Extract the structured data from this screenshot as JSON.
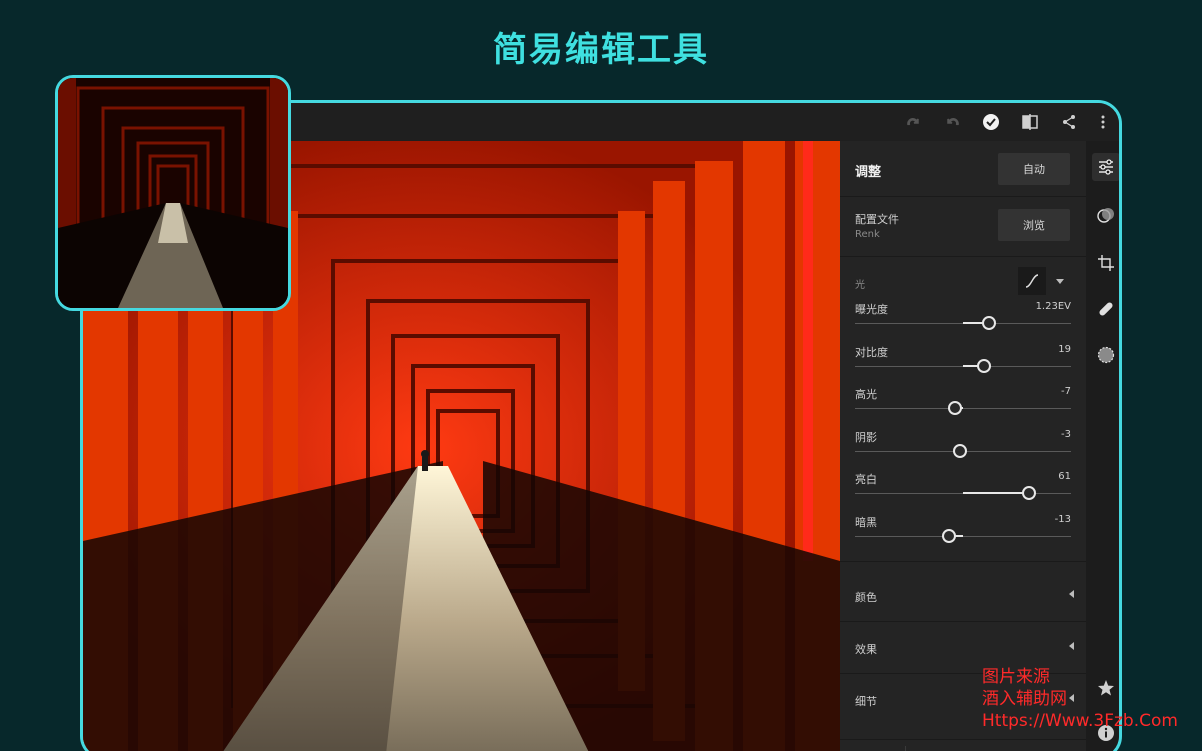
{
  "headline": "简易编辑工具",
  "topbar": {
    "icons": [
      "redo-icon",
      "undo-icon",
      "done-check-icon",
      "compare-icon",
      "share-icon",
      "more-vertical-icon"
    ]
  },
  "panel": {
    "title": "调整",
    "auto_label": "自动",
    "profile_label": "配置文件",
    "profile_value": "Renk",
    "browse_label": "浏览",
    "light_label": "光",
    "sliders": [
      {
        "name": "曝光度",
        "value": "1.23EV",
        "pos": 0.62
      },
      {
        "name": "对比度",
        "value": "19",
        "pos": 0.595
      },
      {
        "name": "高光",
        "value": "-7",
        "pos": 0.465
      },
      {
        "name": "阴影",
        "value": "-3",
        "pos": 0.485
      },
      {
        "name": "亮白",
        "value": "61",
        "pos": 0.805
      },
      {
        "name": "暗黑",
        "value": "-13",
        "pos": 0.435
      }
    ],
    "sections": [
      "颜色",
      "效果",
      "细节"
    ],
    "reset_label": "重置"
  },
  "rail": {
    "icons": [
      "adjust-sliders-icon",
      "presets-icon",
      "crop-icon",
      "healing-icon",
      "selective-icon",
      "star-icon",
      "info-icon"
    ]
  },
  "watermark": {
    "line1": "图片来源",
    "line2": "酒入辅助网",
    "line3": "Https://Www.3Fzb.Com"
  },
  "colors": {
    "accent": "#45d9e0",
    "torii_red": "#d42200",
    "background": "#07282b"
  }
}
